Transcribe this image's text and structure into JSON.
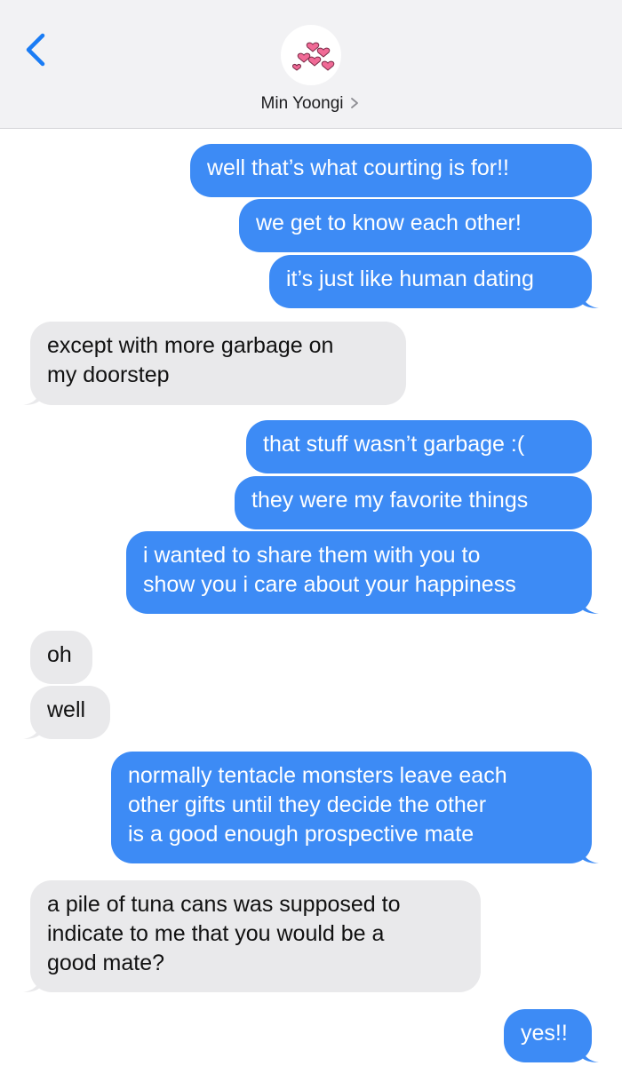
{
  "header": {
    "contact_name": "Min Yoongi",
    "avatar": "hearts-avatar",
    "back_icon": "chevron-left-icon"
  },
  "colors": {
    "outgoing": "#3d8bf5",
    "incoming": "#e9e9eb",
    "accent": "#1a7cf5",
    "heart": "#f06a96"
  },
  "messages": [
    {
      "dir": "out",
      "lines": [
        "well that’s what courting is for!!"
      ]
    },
    {
      "dir": "out",
      "lines": [
        "we get to know each other!"
      ]
    },
    {
      "dir": "out",
      "lines": [
        "it’s just like human dating"
      ]
    },
    {
      "dir": "in",
      "lines": [
        "except with more garbage on",
        "my doorstep"
      ]
    },
    {
      "dir": "out",
      "lines": [
        "that stuff wasn’t garbage :("
      ]
    },
    {
      "dir": "out",
      "lines": [
        "they were my favorite things"
      ]
    },
    {
      "dir": "out",
      "lines": [
        "i wanted to share them with you to",
        "show you i care about your happiness"
      ]
    },
    {
      "dir": "in",
      "lines": [
        "oh"
      ]
    },
    {
      "dir": "in",
      "lines": [
        "well"
      ]
    },
    {
      "dir": "out",
      "lines": [
        "normally tentacle monsters leave each",
        "other gifts until they decide the other",
        "is a good enough prospective mate"
      ]
    },
    {
      "dir": "in",
      "lines": [
        "a pile of tuna cans was supposed to",
        "indicate to me that you would be a",
        "good mate?"
      ]
    },
    {
      "dir": "out",
      "lines": [
        "yes!!"
      ]
    }
  ]
}
